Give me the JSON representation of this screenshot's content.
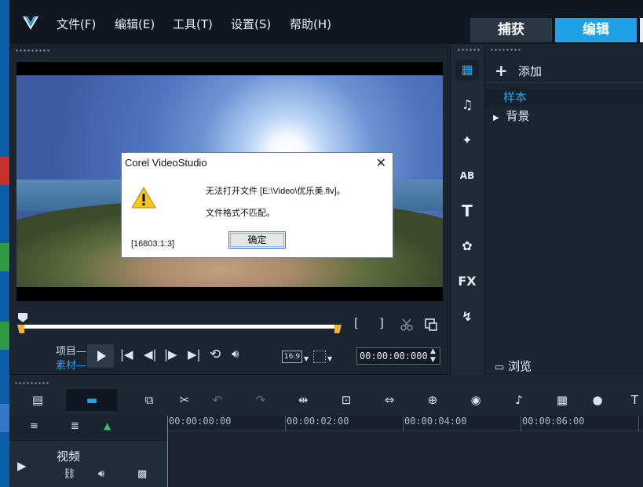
{
  "menu": {
    "file": "文件(F)",
    "edit": "编辑(E)",
    "tools": "工具(T)",
    "settings": "设置(S)",
    "help": "帮助(H)"
  },
  "tabs": {
    "capture": "捕获",
    "edit": "编辑"
  },
  "player": {
    "mode_project": "项目",
    "mode_clip": "素材",
    "aspect": "16:9",
    "timecode": "00:00:00:000",
    "mark_in": "[",
    "mark_out": "]"
  },
  "dialog": {
    "title": "Corel VideoStudio",
    "close": "✕",
    "message": "无法打开文件 [E:\\Video\\优乐美.flv]。",
    "detail": "文件格式不匹配。",
    "ok": "确定",
    "code": "[16803:1:3]"
  },
  "library": {
    "add": "添加",
    "items": [
      "样本",
      "背景"
    ],
    "browse": "浏览",
    "icons": [
      "media-icon",
      "audio-icon",
      "instant-project-icon",
      "transition-icon",
      "title-icon",
      "graphic-icon",
      "filter-icon",
      "path-icon"
    ],
    "icon_text": {
      "transition": "AB",
      "title": "T",
      "filter": "FX"
    }
  },
  "timeline": {
    "ticks": [
      "00:00:00:00",
      "00:00:02:00",
      "00:00:04:00",
      "00:00:06:00"
    ],
    "track_name": "视频"
  },
  "colors": {
    "accent": "#1ea1e6",
    "trim": "#f0b23b",
    "background": "#1c2733"
  }
}
